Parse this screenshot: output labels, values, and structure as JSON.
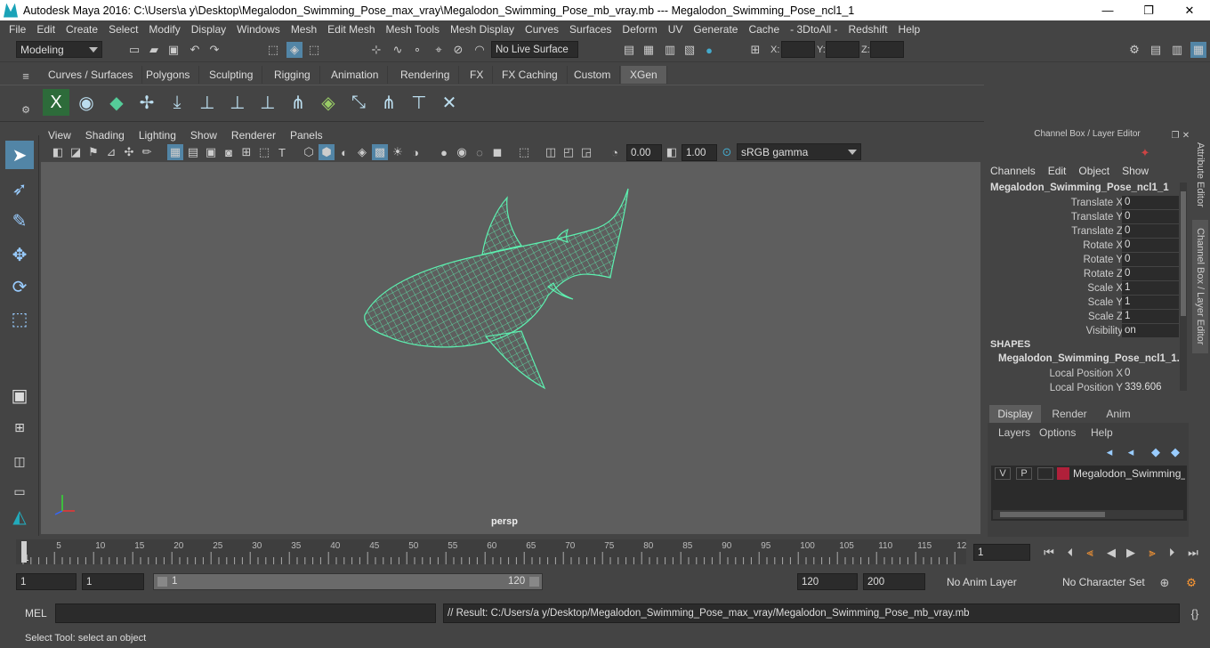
{
  "window": {
    "title": "Autodesk Maya 2016: C:\\Users\\a y\\Desktop\\Megalodon_Swimming_Pose_max_vray\\Megalodon_Swimming_Pose_mb_vray.mb   ---   Megalodon_Swimming_Pose_ncl1_1",
    "minimize": "—",
    "maximize": "❐",
    "close": "✕"
  },
  "menus": [
    "File",
    "Edit",
    "Create",
    "Select",
    "Modify",
    "Display",
    "Windows",
    "Mesh",
    "Edit Mesh",
    "Mesh Tools",
    "Mesh Display",
    "Curves",
    "Surfaces",
    "Deform",
    "UV",
    "Generate",
    "Cache",
    "- 3DtoAll -",
    "Redshift",
    "Help"
  ],
  "status": {
    "mode": "Modeling",
    "live_surface": "No Live Surface",
    "x_label": "X:",
    "y_label": "Y:",
    "z_label": "Z:"
  },
  "shelf_tabs": [
    "Curves / Surfaces",
    "Polygons",
    "Sculpting",
    "Rigging",
    "Animation",
    "Rendering",
    "FX",
    "FX Caching",
    "Custom",
    "XGen"
  ],
  "active_shelf": "XGen",
  "panel_menu": [
    "View",
    "Shading",
    "Lighting",
    "Show",
    "Renderer",
    "Panels"
  ],
  "panel_toolbar": {
    "exposure": "0.00",
    "gamma": "1.00",
    "color_space": "sRGB gamma"
  },
  "viewport": {
    "camera": "persp"
  },
  "channel_box": {
    "header": "Channel Box / Layer Editor",
    "menu": [
      "Channels",
      "Edit",
      "Object",
      "Show"
    ],
    "object": "Megalodon_Swimming_Pose_ncl1_1",
    "channels": [
      {
        "label": "Translate X",
        "value": "0"
      },
      {
        "label": "Translate Y",
        "value": "0"
      },
      {
        "label": "Translate Z",
        "value": "0"
      },
      {
        "label": "Rotate X",
        "value": "0"
      },
      {
        "label": "Rotate Y",
        "value": "0"
      },
      {
        "label": "Rotate Z",
        "value": "0"
      },
      {
        "label": "Scale X",
        "value": "1"
      },
      {
        "label": "Scale Y",
        "value": "1"
      },
      {
        "label": "Scale Z",
        "value": "1"
      },
      {
        "label": "Visibility",
        "value": "on"
      }
    ],
    "shapes_label": "SHAPES",
    "shape_name": "Megalodon_Swimming_Pose_ncl1_1...",
    "shape_channels": [
      {
        "label": "Local Position X",
        "value": "0"
      },
      {
        "label": "Local Position Y",
        "value": "339.606"
      }
    ]
  },
  "side_tabs": [
    "Attribute Editor",
    "Channel Box / Layer Editor"
  ],
  "layers": {
    "tabs": [
      "Display",
      "Render",
      "Anim"
    ],
    "menu": [
      "Layers",
      "Options",
      "Help"
    ],
    "layer": {
      "v": "V",
      "p": "P",
      "name": "Megalodon_Swimming_Pose",
      "color": "#b0203a"
    }
  },
  "timeline": {
    "ticks": [
      "1",
      "5",
      "10",
      "15",
      "20",
      "25",
      "30",
      "35",
      "40",
      "45",
      "50",
      "55",
      "60",
      "65",
      "70",
      "75",
      "80",
      "85",
      "90",
      "95",
      "100",
      "105",
      "110",
      "115",
      "12"
    ],
    "current_frame": "1"
  },
  "range": {
    "start": "1",
    "playback_start": "1",
    "slider_start": "1",
    "slider_end": "120",
    "playback_end": "120",
    "end": "200",
    "anim_layer": "No Anim Layer",
    "char_set": "No Character Set"
  },
  "command": {
    "lang": "MEL",
    "result": "// Result: C:/Users/a y/Desktop/Megalodon_Swimming_Pose_max_vray/Megalodon_Swimming_Pose_mb_vray.mb"
  },
  "help_line": "Select Tool: select an object",
  "colors": {
    "wire": "#5df0b0",
    "viewport_bg": "#5e5e5e",
    "accent": "#5285a6"
  }
}
